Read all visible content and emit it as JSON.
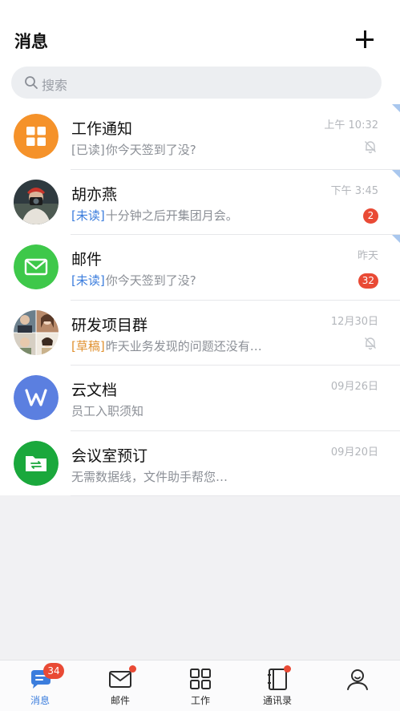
{
  "header": {
    "title": "消息"
  },
  "search": {
    "placeholder": "搜索"
  },
  "conversations": [
    {
      "name": "工作通知",
      "tag": "[已读]",
      "text": "你今天签到了没?",
      "time": "上午 10:32",
      "muted": true,
      "pinned": true,
      "avatar": "grid-app-icon",
      "avatar_color": "#f5922a"
    },
    {
      "name": "胡亦燕",
      "tag": "[未读]",
      "text": "十分钟之后开集团月会。",
      "time": "下午 3:45",
      "badge": "2",
      "pinned": true,
      "avatar": "user-photo"
    },
    {
      "name": "邮件",
      "tag": "[未读]",
      "text": "你今天签到了没?",
      "time": "昨天",
      "badge": "32",
      "pinned": true,
      "avatar": "mail-app-icon",
      "avatar_color": "#3ec84a"
    },
    {
      "name": "研发项目群",
      "tag": "[草稿]",
      "text": "昨天业务发现的问题还没有…",
      "time": "12月30日",
      "muted": true,
      "avatar": "group-photo"
    },
    {
      "name": "云文档",
      "tag": "",
      "text": "员工入职须知",
      "time": "09月26日",
      "avatar": "document-app-icon",
      "avatar_color": "#5b7fe0"
    },
    {
      "name": "会议室预订",
      "tag": "",
      "text": "无需数据线，文件助手帮您…",
      "time": "09月20日",
      "avatar": "file-transfer-icon",
      "avatar_color": "#1aa83c"
    }
  ],
  "tabbar": {
    "items": [
      {
        "label": "消息",
        "badge": "34",
        "active": true,
        "icon": "chat-bubble-icon"
      },
      {
        "label": "邮件",
        "dot": true,
        "icon": "mail-icon"
      },
      {
        "label": "工作",
        "icon": "apps-grid-icon"
      },
      {
        "label": "通讯录",
        "dot": true,
        "icon": "contacts-book-icon"
      },
      {
        "label": "",
        "icon": "profile-icon"
      }
    ]
  },
  "colors": {
    "accent": "#3b7ddd",
    "badge": "#e94a35",
    "unread_tag": "#3b7ddd",
    "draft_tag": "#e0902e"
  }
}
